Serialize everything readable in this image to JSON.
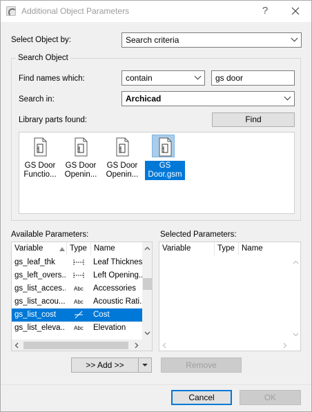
{
  "window": {
    "title": "Additional Object Parameters",
    "help_btn": "?",
    "close_btn": "X"
  },
  "select_by": {
    "label": "Select Object by:",
    "value": "Search criteria"
  },
  "search_object": {
    "group_title": "Search Object",
    "find_names_label": "Find names which:",
    "match_mode": "contain",
    "query": "gs door",
    "search_in_label": "Search in:",
    "search_in_value": "Archicad",
    "found_label": "Library parts found:",
    "find_button": "Find",
    "parts": [
      {
        "line1": "GS Door",
        "line2": "Functio..."
      },
      {
        "line1": "GS Door",
        "line2": "Openin..."
      },
      {
        "line1": "GS Door",
        "line2": "Openin..."
      },
      {
        "line1": "GS",
        "line2": "Door.gsm"
      }
    ]
  },
  "available": {
    "label": "Available Parameters:",
    "col_variable": "Variable",
    "col_type": "Type",
    "col_name": "Name",
    "rows": [
      {
        "variable": "gs_leaf_thk",
        "type": "length",
        "name": "Leaf Thickness"
      },
      {
        "variable": "gs_left_overs...",
        "type": "length",
        "name": "Left Opening..."
      },
      {
        "variable": "gs_list_acces...",
        "type": "Abc",
        "name": "Accessories"
      },
      {
        "variable": "gs_list_acou...",
        "type": "Abc",
        "name": "Acoustic Rati..."
      },
      {
        "variable": "gs_list_cost",
        "type": "real",
        "name": "Cost"
      },
      {
        "variable": "gs_list_eleva...",
        "type": "Abc",
        "name": "Elevation"
      }
    ]
  },
  "selected": {
    "label": "Selected Parameters:",
    "col_variable": "Variable",
    "col_type": "Type",
    "col_name": "Name"
  },
  "buttons": {
    "add": ">> Add >>",
    "remove": "Remove",
    "cancel": "Cancel",
    "ok": "OK"
  }
}
